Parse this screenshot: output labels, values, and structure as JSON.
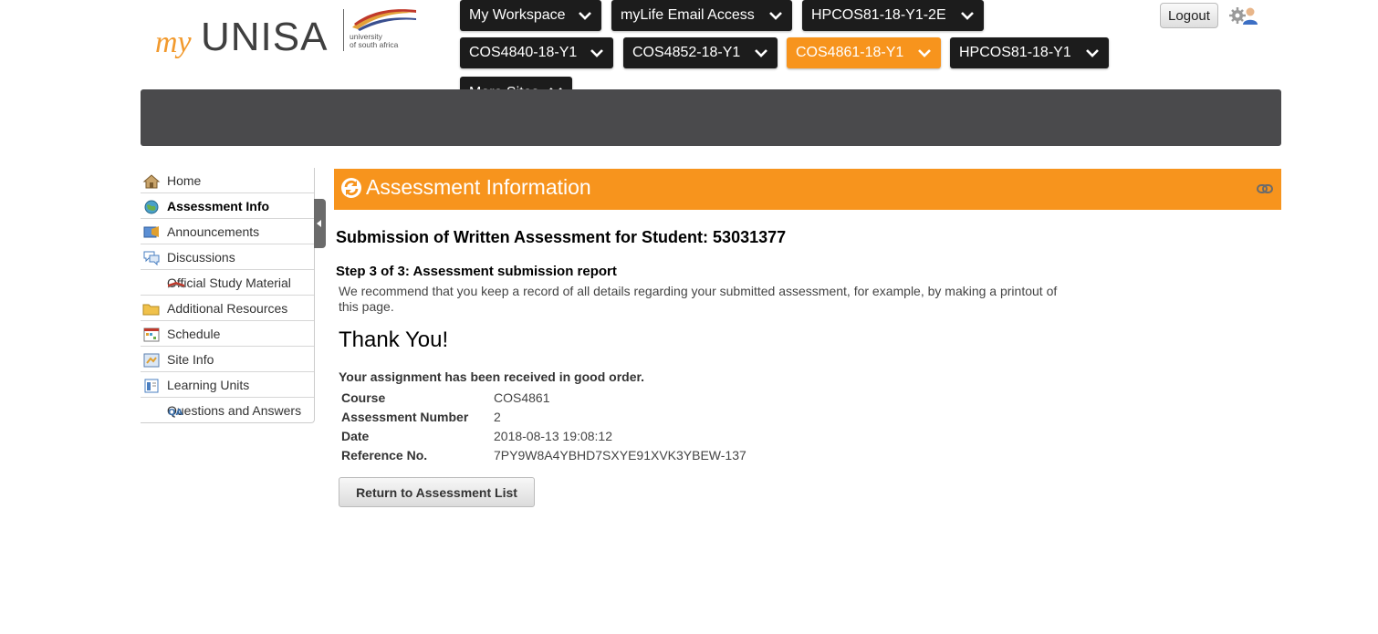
{
  "logo": {
    "my": "my",
    "unisa": "UNISA",
    "uni_line1": "university",
    "uni_line2": "of south africa"
  },
  "sites": [
    {
      "label": "My Workspace"
    },
    {
      "label": "myLife Email Access"
    },
    {
      "label": "HPCOS81-18-Y1-2E"
    },
    {
      "label": "COS4840-18-Y1"
    },
    {
      "label": "COS4852-18-Y1"
    },
    {
      "label": "COS4861-18-Y1",
      "active": true
    },
    {
      "label": "HPCOS81-18-Y1"
    },
    {
      "label": "More Sites"
    }
  ],
  "header": {
    "logout_label": "Logout",
    "user_icon": "user-settings-icon"
  },
  "toolmenu": {
    "items": [
      {
        "label": "Home",
        "icon": "home-icon"
      },
      {
        "label": "Assessment Info",
        "icon": "globe-icon",
        "selected": true
      },
      {
        "label": "Announcements",
        "icon": "announcements-icon"
      },
      {
        "label": "Discussions",
        "icon": "discussions-icon"
      },
      {
        "label": "Official Study Material",
        "icon": "book-icon"
      },
      {
        "label": "Additional Resources",
        "icon": "folder-icon"
      },
      {
        "label": "Schedule",
        "icon": "calendar-icon"
      },
      {
        "label": "Site Info",
        "icon": "site-info-icon"
      },
      {
        "label": "Learning Units",
        "icon": "learning-units-icon"
      },
      {
        "label": "Questions and Answers",
        "icon": "qa-icon"
      }
    ]
  },
  "portlet": {
    "title": "Assessment Information",
    "reset_icon": "reset-icon",
    "link_icon": "link-icon"
  },
  "content": {
    "heading": "Submission of Written Assessment for Student: 53031377",
    "step": "Step 3 of 3: Assessment submission report",
    "instruction": "We recommend that you keep a record of all details regarding your submitted assessment, for example, by making a printout of this page.",
    "thank_you": "Thank You!",
    "received": "Your assignment has been received in good order.",
    "details": [
      {
        "label": "Course",
        "value": "COS4861"
      },
      {
        "label": "Assessment Number",
        "value": "2"
      },
      {
        "label": "Date",
        "value": "2018-08-13 19:08:12"
      },
      {
        "label": "Reference No.",
        "value": "7PY9W8A4YBHD7SXYE91XVK3YBEW-137"
      }
    ],
    "return_button": "Return to Assessment List"
  },
  "colors": {
    "accent": "#f7941d",
    "nav_dark": "#1c1c1c",
    "banner": "#4a4a4c"
  }
}
